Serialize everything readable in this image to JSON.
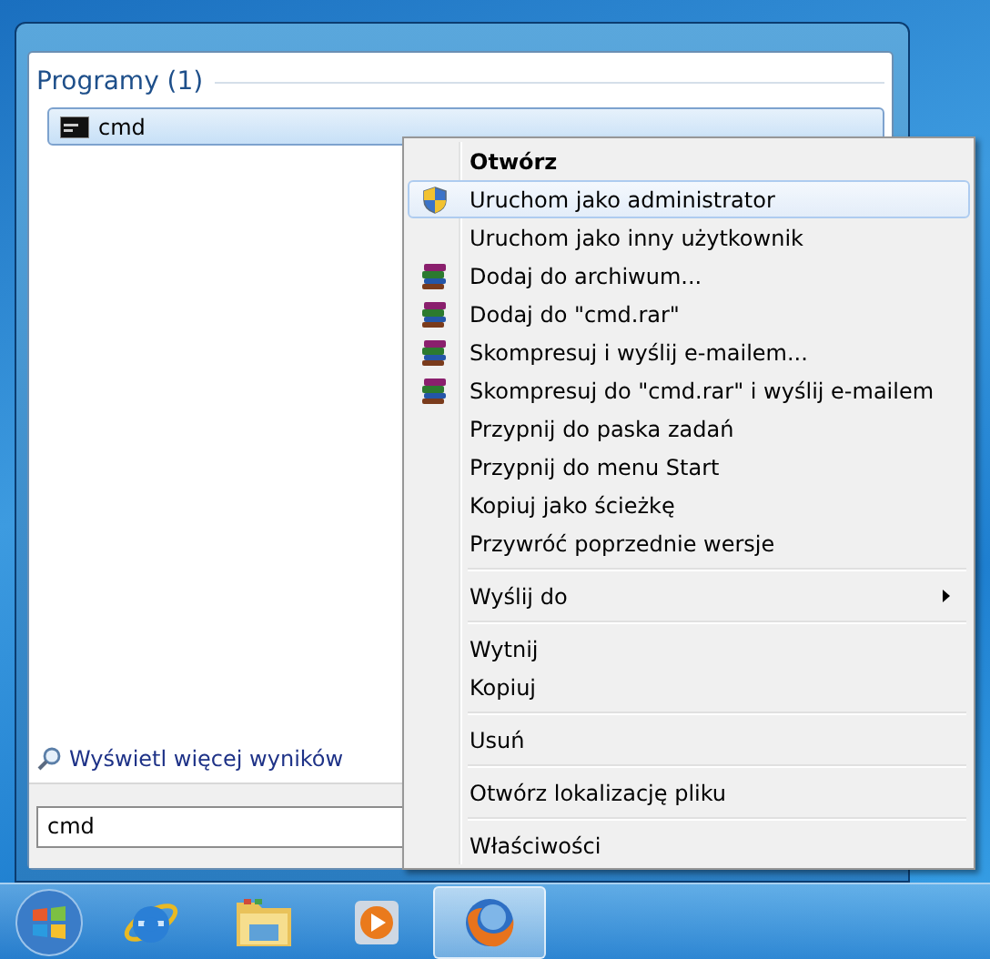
{
  "start_menu": {
    "section_title": "Programy (1)",
    "results": [
      {
        "label": "cmd",
        "selected": true
      }
    ],
    "more_results": "Wyświetl więcej wyników",
    "search": {
      "value": "cmd"
    }
  },
  "context_menu": {
    "items": [
      {
        "kind": "default",
        "label": "Otwórz",
        "selected": false
      },
      {
        "kind": "elevated",
        "label": "Uruchom jako administrator",
        "selected": true
      },
      {
        "kind": "plain",
        "label": "Uruchom jako inny użytkownik",
        "selected": false
      },
      {
        "kind": "archive",
        "label": "Dodaj do archiwum...",
        "selected": false
      },
      {
        "kind": "archive",
        "label": "Dodaj do \"cmd.rar\"",
        "selected": false
      },
      {
        "kind": "archive",
        "label": "Skompresuj i wyślij e-mailem...",
        "selected": false
      },
      {
        "kind": "archive",
        "label": "Skompresuj do \"cmd.rar\" i wyślij e-mailem",
        "selected": false
      },
      {
        "kind": "plain",
        "label": "Przypnij do paska zadań",
        "selected": false
      },
      {
        "kind": "plain",
        "label": "Przypnij do menu Start",
        "selected": false
      },
      {
        "kind": "plain",
        "label": "Kopiuj jako ścieżkę",
        "selected": false
      },
      {
        "kind": "plain",
        "label": "Przywróć poprzednie wersje",
        "selected": false
      },
      {
        "kind": "separator"
      },
      {
        "kind": "submenu",
        "label": "Wyślij do",
        "selected": false
      },
      {
        "kind": "separator"
      },
      {
        "kind": "plain",
        "label": "Wytnij",
        "selected": false
      },
      {
        "kind": "plain",
        "label": "Kopiuj",
        "selected": false
      },
      {
        "kind": "separator"
      },
      {
        "kind": "plain",
        "label": "Usuń",
        "selected": false
      },
      {
        "kind": "separator"
      },
      {
        "kind": "plain",
        "label": "Otwórz lokalizację pliku",
        "selected": false
      },
      {
        "kind": "separator"
      },
      {
        "kind": "plain",
        "label": "Właściwości",
        "selected": false
      }
    ]
  },
  "taskbar": {
    "items": [
      {
        "kind": "browser-e",
        "active": false
      },
      {
        "kind": "folder",
        "active": false
      },
      {
        "kind": "media",
        "active": false
      },
      {
        "kind": "browser-fox",
        "active": true
      }
    ]
  }
}
